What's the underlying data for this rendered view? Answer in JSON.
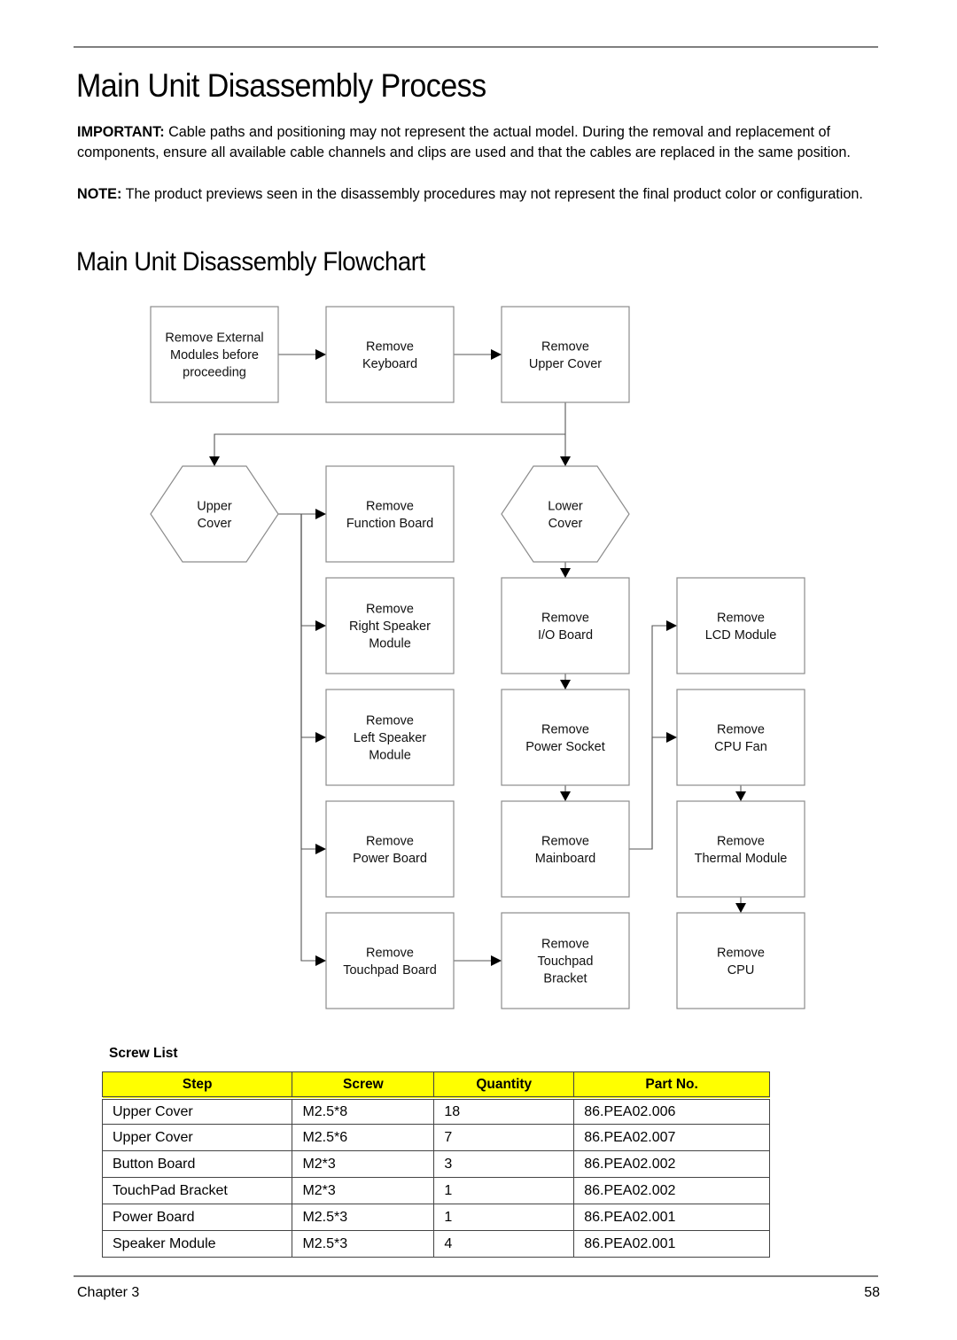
{
  "page": {
    "title": "Main Unit Disassembly Process",
    "important_label": "IMPORTANT:",
    "important_text": " Cable paths and positioning may not represent the actual model. During the removal and replacement of components, ensure all available cable channels and clips are used and that the cables are replaced in the same position.",
    "note_label": "NOTE:",
    "note_text": " The product previews seen in the disassembly procedures may not represent the final product color or configuration.",
    "subtitle": "Main Unit Disassembly Flowchart"
  },
  "flowchart": {
    "nodes": [
      {
        "id": "external",
        "shape": "box",
        "lines": [
          "Remove External",
          "Modules before",
          "proceeding"
        ]
      },
      {
        "id": "keyboard",
        "shape": "box",
        "lines": [
          "Remove",
          "Keyboard"
        ]
      },
      {
        "id": "upper-cover-remove",
        "shape": "box",
        "lines": [
          "Remove",
          "Upper Cover"
        ]
      },
      {
        "id": "upper-cover-group",
        "shape": "hexagon",
        "lines": [
          "Upper",
          "Cover"
        ]
      },
      {
        "id": "function-board",
        "shape": "box",
        "lines": [
          "Remove",
          "Function Board"
        ]
      },
      {
        "id": "lower-cover-group",
        "shape": "hexagon",
        "lines": [
          "Lower",
          "Cover"
        ]
      },
      {
        "id": "right-speaker",
        "shape": "box",
        "lines": [
          "Remove",
          "Right Speaker",
          "Module"
        ]
      },
      {
        "id": "io-board",
        "shape": "box",
        "lines": [
          "Remove",
          "I/O Board"
        ]
      },
      {
        "id": "lcd-module",
        "shape": "box",
        "lines": [
          "Remove",
          "LCD Module"
        ]
      },
      {
        "id": "left-speaker",
        "shape": "box",
        "lines": [
          "Remove",
          "Left Speaker",
          "Module"
        ]
      },
      {
        "id": "power-socket",
        "shape": "box",
        "lines": [
          "Remove",
          "Power Socket"
        ]
      },
      {
        "id": "cpu-fan",
        "shape": "box",
        "lines": [
          "Remove",
          "CPU Fan"
        ]
      },
      {
        "id": "power-board",
        "shape": "box",
        "lines": [
          "Remove",
          "Power Board"
        ]
      },
      {
        "id": "mainboard",
        "shape": "box",
        "lines": [
          "Remove",
          "Mainboard"
        ]
      },
      {
        "id": "thermal-module",
        "shape": "box",
        "lines": [
          "Remove",
          "Thermal Module"
        ]
      },
      {
        "id": "touchpad-board",
        "shape": "box",
        "lines": [
          "Remove",
          "Touchpad Board"
        ]
      },
      {
        "id": "touchpad-bracket",
        "shape": "box",
        "lines": [
          "Remove",
          "Touchpad",
          "Bracket"
        ]
      },
      {
        "id": "cpu",
        "shape": "box",
        "lines": [
          "Remove",
          "CPU"
        ]
      }
    ],
    "edges": [
      [
        "external",
        "keyboard"
      ],
      [
        "keyboard",
        "upper-cover-remove"
      ],
      [
        "upper-cover-remove",
        "upper-cover-group"
      ],
      [
        "upper-cover-remove",
        "lower-cover-group"
      ],
      [
        "upper-cover-group",
        "function-board"
      ],
      [
        "upper-cover-group",
        "right-speaker"
      ],
      [
        "upper-cover-group",
        "left-speaker"
      ],
      [
        "upper-cover-group",
        "power-board"
      ],
      [
        "upper-cover-group",
        "touchpad-board"
      ],
      [
        "touchpad-board",
        "touchpad-bracket"
      ],
      [
        "lower-cover-group",
        "io-board"
      ],
      [
        "io-board",
        "power-socket"
      ],
      [
        "power-socket",
        "mainboard"
      ],
      [
        "mainboard",
        "lcd-module"
      ],
      [
        "mainboard",
        "cpu-fan"
      ],
      [
        "cpu-fan",
        "thermal-module"
      ],
      [
        "thermal-module",
        "cpu"
      ]
    ]
  },
  "screw_list": {
    "label": "Screw List",
    "header_color": "#ffff00",
    "columns": [
      "Step",
      "Screw",
      "Quantity",
      "Part No."
    ],
    "rows": [
      [
        "Upper Cover",
        "M2.5*8",
        "18",
        "86.PEA02.006"
      ],
      [
        "Upper Cover",
        "M2.5*6",
        "7",
        "86.PEA02.007"
      ],
      [
        "Button Board",
        "M2*3",
        "3",
        "86.PEA02.002"
      ],
      [
        "TouchPad Bracket",
        "M2*3",
        "1",
        "86.PEA02.002"
      ],
      [
        "Power Board",
        "M2.5*3",
        "1",
        "86.PEA02.001"
      ],
      [
        "Speaker Module",
        "M2.5*3",
        "4",
        "86.PEA02.001"
      ]
    ]
  },
  "footer": {
    "chapter": "Chapter 3",
    "page_number": "58"
  }
}
